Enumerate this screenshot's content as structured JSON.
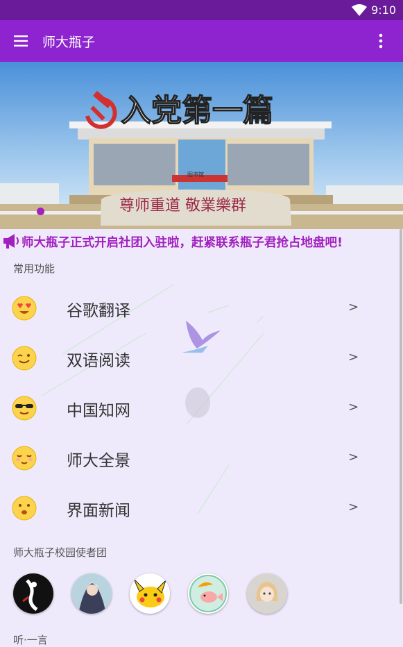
{
  "status_bar": {
    "time": "9:10",
    "wifi_icon": "wifi-icon"
  },
  "app_bar": {
    "title": "师大瓶子",
    "menu_icon": "hamburger-menu-icon",
    "more_icon": "more-vert-icon"
  },
  "banner": {
    "headline": "入党第一篇",
    "stone_inscription": "尊师重道 敬業樂群",
    "building_sign": "图书馆",
    "active_slide": 1
  },
  "notice": {
    "icon": "megaphone-icon",
    "text": "师大瓶子正式开启社团入驻啦，赶紧联系瓶子君抢占地盘吧!"
  },
  "common_functions": {
    "title": "常用功能",
    "items": [
      {
        "label": "谷歌翻译",
        "chevron": ">",
        "icon": "heart-eyes-emoji-icon"
      },
      {
        "label": "双语阅读",
        "chevron": ">",
        "icon": "smile-emoji-icon"
      },
      {
        "label": "中国知网",
        "chevron": ">",
        "icon": "sunglasses-emoji-icon"
      },
      {
        "label": "师大全景",
        "chevron": ">",
        "icon": "blush-emoji-icon"
      },
      {
        "label": "界面新闻",
        "chevron": ">",
        "icon": "happy-emoji-icon"
      }
    ]
  },
  "ambassadors": {
    "title": "师大瓶子校园使者团",
    "avatars": [
      "avatar-ink-figure",
      "avatar-anime-swordsman",
      "avatar-pikachu",
      "avatar-fish-umbrella",
      "avatar-anime-girl"
    ]
  },
  "quote_section": {
    "title": "听·一言"
  },
  "colors": {
    "status_bar": "#6a1b9a",
    "app_bar": "#8e24cf",
    "accent": "#a21fc0",
    "background": "#efeafb"
  }
}
